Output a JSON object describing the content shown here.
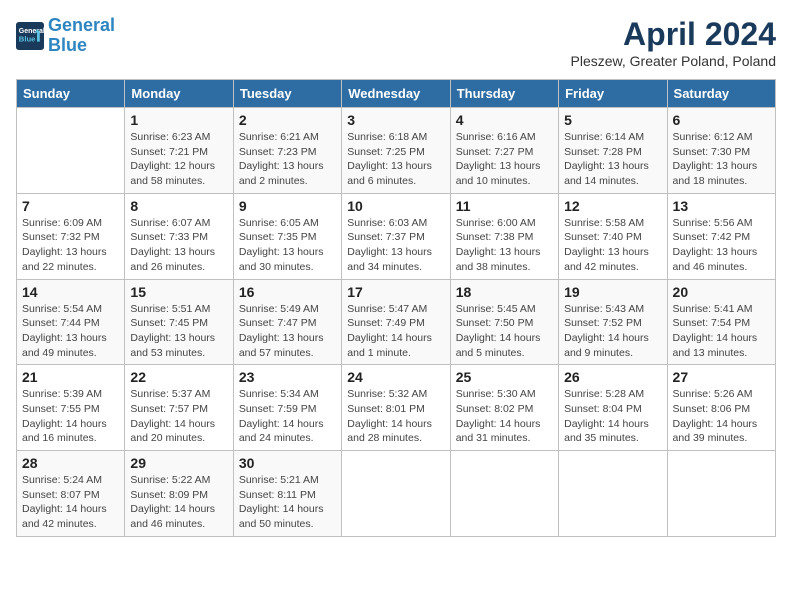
{
  "header": {
    "logo_line1": "General",
    "logo_line2": "Blue",
    "month": "April 2024",
    "location": "Pleszew, Greater Poland, Poland"
  },
  "weekdays": [
    "Sunday",
    "Monday",
    "Tuesday",
    "Wednesday",
    "Thursday",
    "Friday",
    "Saturday"
  ],
  "weeks": [
    [
      {
        "day": "",
        "details": ""
      },
      {
        "day": "1",
        "details": "Sunrise: 6:23 AM\nSunset: 7:21 PM\nDaylight: 12 hours\nand 58 minutes."
      },
      {
        "day": "2",
        "details": "Sunrise: 6:21 AM\nSunset: 7:23 PM\nDaylight: 13 hours\nand 2 minutes."
      },
      {
        "day": "3",
        "details": "Sunrise: 6:18 AM\nSunset: 7:25 PM\nDaylight: 13 hours\nand 6 minutes."
      },
      {
        "day": "4",
        "details": "Sunrise: 6:16 AM\nSunset: 7:27 PM\nDaylight: 13 hours\nand 10 minutes."
      },
      {
        "day": "5",
        "details": "Sunrise: 6:14 AM\nSunset: 7:28 PM\nDaylight: 13 hours\nand 14 minutes."
      },
      {
        "day": "6",
        "details": "Sunrise: 6:12 AM\nSunset: 7:30 PM\nDaylight: 13 hours\nand 18 minutes."
      }
    ],
    [
      {
        "day": "7",
        "details": "Sunrise: 6:09 AM\nSunset: 7:32 PM\nDaylight: 13 hours\nand 22 minutes."
      },
      {
        "day": "8",
        "details": "Sunrise: 6:07 AM\nSunset: 7:33 PM\nDaylight: 13 hours\nand 26 minutes."
      },
      {
        "day": "9",
        "details": "Sunrise: 6:05 AM\nSunset: 7:35 PM\nDaylight: 13 hours\nand 30 minutes."
      },
      {
        "day": "10",
        "details": "Sunrise: 6:03 AM\nSunset: 7:37 PM\nDaylight: 13 hours\nand 34 minutes."
      },
      {
        "day": "11",
        "details": "Sunrise: 6:00 AM\nSunset: 7:38 PM\nDaylight: 13 hours\nand 38 minutes."
      },
      {
        "day": "12",
        "details": "Sunrise: 5:58 AM\nSunset: 7:40 PM\nDaylight: 13 hours\nand 42 minutes."
      },
      {
        "day": "13",
        "details": "Sunrise: 5:56 AM\nSunset: 7:42 PM\nDaylight: 13 hours\nand 46 minutes."
      }
    ],
    [
      {
        "day": "14",
        "details": "Sunrise: 5:54 AM\nSunset: 7:44 PM\nDaylight: 13 hours\nand 49 minutes."
      },
      {
        "day": "15",
        "details": "Sunrise: 5:51 AM\nSunset: 7:45 PM\nDaylight: 13 hours\nand 53 minutes."
      },
      {
        "day": "16",
        "details": "Sunrise: 5:49 AM\nSunset: 7:47 PM\nDaylight: 13 hours\nand 57 minutes."
      },
      {
        "day": "17",
        "details": "Sunrise: 5:47 AM\nSunset: 7:49 PM\nDaylight: 14 hours\nand 1 minute."
      },
      {
        "day": "18",
        "details": "Sunrise: 5:45 AM\nSunset: 7:50 PM\nDaylight: 14 hours\nand 5 minutes."
      },
      {
        "day": "19",
        "details": "Sunrise: 5:43 AM\nSunset: 7:52 PM\nDaylight: 14 hours\nand 9 minutes."
      },
      {
        "day": "20",
        "details": "Sunrise: 5:41 AM\nSunset: 7:54 PM\nDaylight: 14 hours\nand 13 minutes."
      }
    ],
    [
      {
        "day": "21",
        "details": "Sunrise: 5:39 AM\nSunset: 7:55 PM\nDaylight: 14 hours\nand 16 minutes."
      },
      {
        "day": "22",
        "details": "Sunrise: 5:37 AM\nSunset: 7:57 PM\nDaylight: 14 hours\nand 20 minutes."
      },
      {
        "day": "23",
        "details": "Sunrise: 5:34 AM\nSunset: 7:59 PM\nDaylight: 14 hours\nand 24 minutes."
      },
      {
        "day": "24",
        "details": "Sunrise: 5:32 AM\nSunset: 8:01 PM\nDaylight: 14 hours\nand 28 minutes."
      },
      {
        "day": "25",
        "details": "Sunrise: 5:30 AM\nSunset: 8:02 PM\nDaylight: 14 hours\nand 31 minutes."
      },
      {
        "day": "26",
        "details": "Sunrise: 5:28 AM\nSunset: 8:04 PM\nDaylight: 14 hours\nand 35 minutes."
      },
      {
        "day": "27",
        "details": "Sunrise: 5:26 AM\nSunset: 8:06 PM\nDaylight: 14 hours\nand 39 minutes."
      }
    ],
    [
      {
        "day": "28",
        "details": "Sunrise: 5:24 AM\nSunset: 8:07 PM\nDaylight: 14 hours\nand 42 minutes."
      },
      {
        "day": "29",
        "details": "Sunrise: 5:22 AM\nSunset: 8:09 PM\nDaylight: 14 hours\nand 46 minutes."
      },
      {
        "day": "30",
        "details": "Sunrise: 5:21 AM\nSunset: 8:11 PM\nDaylight: 14 hours\nand 50 minutes."
      },
      {
        "day": "",
        "details": ""
      },
      {
        "day": "",
        "details": ""
      },
      {
        "day": "",
        "details": ""
      },
      {
        "day": "",
        "details": ""
      }
    ]
  ]
}
